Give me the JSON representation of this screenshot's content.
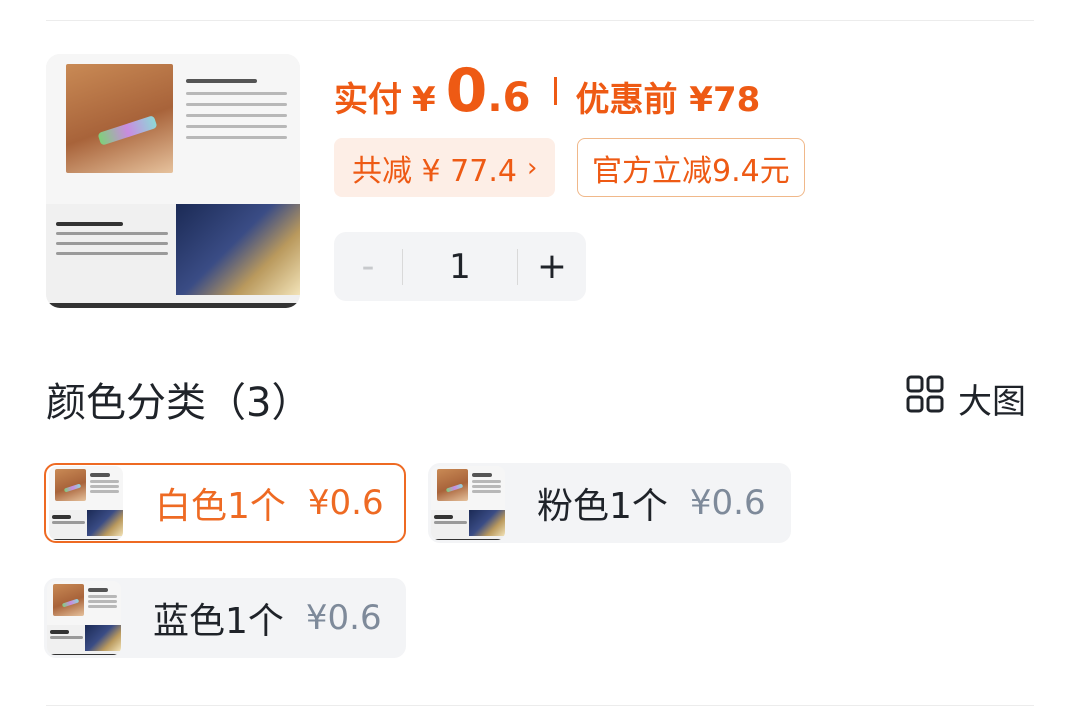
{
  "price": {
    "pay_label": "实付",
    "currency": "¥",
    "amount_int": "0",
    "amount_dec": ".6",
    "original_label": "优惠前 ¥78"
  },
  "tags": {
    "discount_total": "共减 ¥ 77.4",
    "discount_arrow": "›",
    "official_cut": "官方立减9.4元"
  },
  "stepper": {
    "minus": "-",
    "quantity": "1",
    "plus": "+"
  },
  "section": {
    "title": "颜色分类（3）",
    "big_image_label": "大图"
  },
  "variants": [
    {
      "label": "白色1个",
      "price": "¥0.6",
      "selected": true
    },
    {
      "label": "粉色1个",
      "price": "¥0.6",
      "selected": false
    },
    {
      "label": "蓝色1个",
      "price": "¥0.6",
      "selected": false
    }
  ],
  "colors": {
    "accent": "#ee5a14",
    "chip_bg": "#f3f4f6",
    "muted_price": "#7e8a9a",
    "discount_bg": "#fdeee6"
  },
  "icons": {
    "big_image": "grid-icon",
    "discount_arrow": "chevron-right-icon"
  }
}
